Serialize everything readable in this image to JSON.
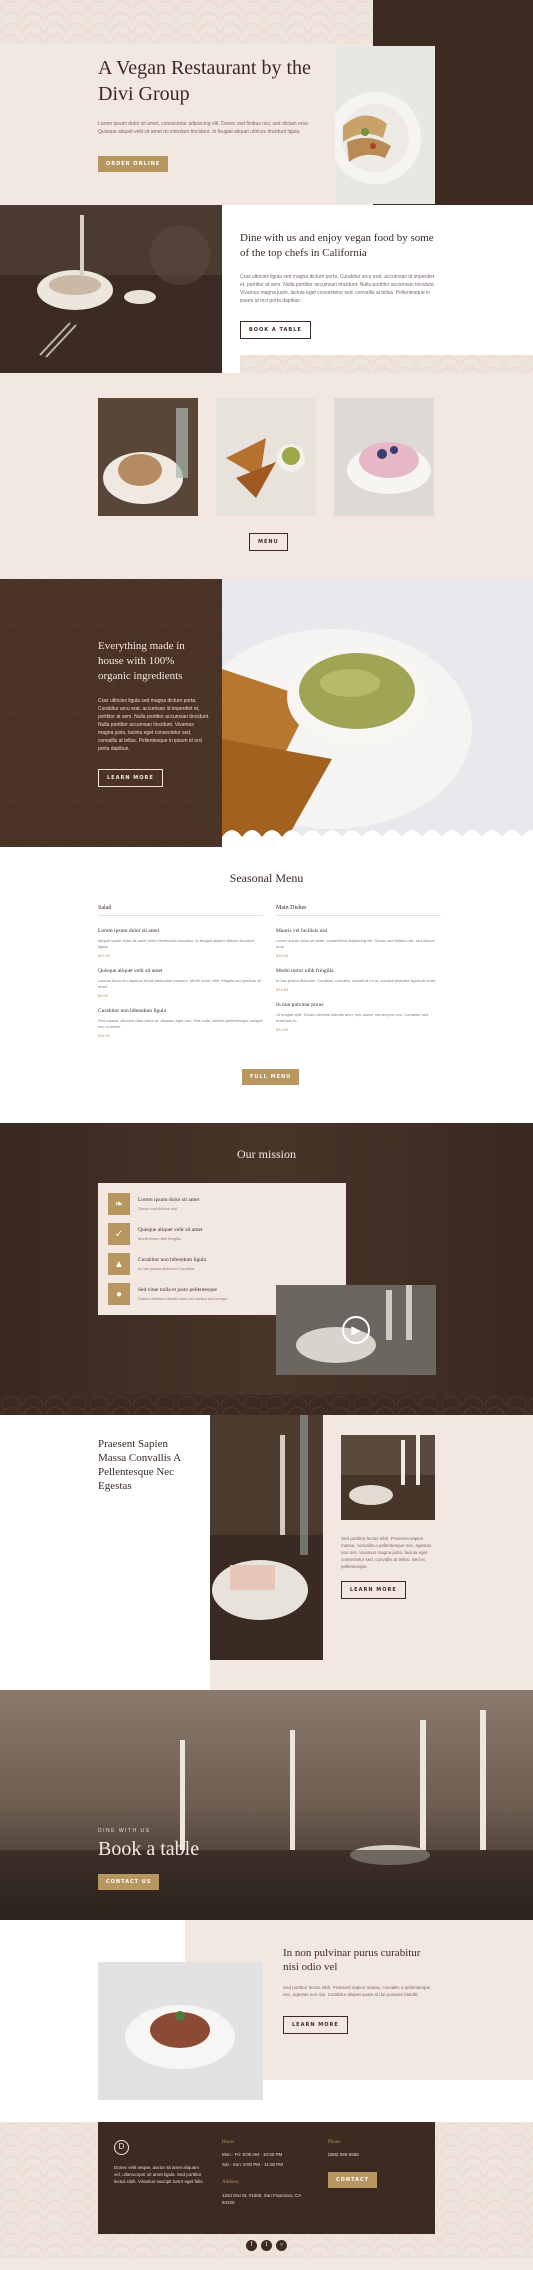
{
  "hero": {
    "title": "A Vegan Restaurant by the Divi Group",
    "text": "Lorem ipsum dolor sit amet, consectetur adipiscing elit. Donec sed finibus nisi, sed dictum eros. Quisque aliquet velit sit amet mi interdum tincidunt. In feugiat aliquet ultrices tincidunt ligula.",
    "button": "Order Online"
  },
  "dine": {
    "title": "Dine with us and enjoy vegan food by some of the top chefs in California",
    "text": "Cras ultricies ligula sed magna dictum porta. Curabitur arcu erat, accumsan id imperdiet et, porttitor at sem. Nulla porttitor accumsan tincidunt. Nulla porttitor accumsan tincidunt. Vivamus magna justo, lacinia eget consectetur sed, convallis at tellus. Pellentesque in ipsum id orci porta dapibus.",
    "button": "Book a table"
  },
  "gallery": {
    "button": "Menu"
  },
  "organic": {
    "title": "Everything made in house with 100% organic ingredients",
    "text": "Cras ultricies ligula sed magna dictum porta. Curabitur arcu erat, accumsan id imperdiet et, porttitor at sem. Nulla porttitor accumsan tincidunt. Nulla porttitor accumsan tincidunt. Vivamus magna justo, lacinia eget consectetur sed, convallis at tellus. Pellentesque in ipsum id orci porta dapibus.",
    "button": "Learn more"
  },
  "menu": {
    "title": "Seasonal Menu",
    "columns": [
      {
        "heading": "Salad",
        "items": [
          {
            "name": "Lorem ipsum dolor sit amet",
            "desc": "Aliquet quam dolor sit amet enim elementum faucibus. In feugiat aliquet ultrices tincidunt ligula.",
            "price": "$12.00"
          },
          {
            "name": "Quisque aliquet velit sit amet",
            "desc": "Lacinia tortor leo dapibus turpis bibendum posuere. Morbi tortor nibh, fringilla sed pretium sit amet.",
            "price": "$9.00"
          },
          {
            "name": "Curabitur non bibendum ligula",
            "desc": "Sed massa, ultricies vitae tortor at, aliquam eget orci. Sed nulla, ultrices pellentesque congue nec ut lorem.",
            "price": "$11.50"
          }
        ]
      },
      {
        "heading": "Main Dishes",
        "items": [
          {
            "name": "Mauris vel facilisis nisl",
            "desc": "Lorem ipsum dolor sit amet, consectetur adipiscing elit. Donec sed finibus nisi, sed dictum eros.",
            "price": "$16.00"
          },
          {
            "name": "Morbi tortor nibh fringilla",
            "desc": "In hac platea dictumst. Curabitur convallis, blandit id mi ut, suscipit pharetra ligula sit amet.",
            "price": "$18.50"
          },
          {
            "name": "In non pulvinar purus",
            "desc": "Ut feugiat velit. Donec ultricies lobortis arcu, nec auctor nisi tempor non. Curabitur sed euismod ex.",
            "price": "$14.00"
          }
        ]
      }
    ],
    "button": "Full menu"
  },
  "mission": {
    "title": "Our mission",
    "items": [
      {
        "icon": "leaf-icon",
        "title": "Lorem ipsum dolor sit amet",
        "desc": "Donec sed finibus nisi"
      },
      {
        "icon": "vegan-icon",
        "title": "Quisque aliquet velit sit amet",
        "desc": "Morbi tortor nibh fringilla"
      },
      {
        "icon": "carrot-icon",
        "title": "Curabitur non bibendum ligula",
        "desc": "In hac platea dictumst Curabitur"
      },
      {
        "icon": "onion-icon",
        "title": "Sed vitae nulla et justo pellentesque",
        "desc": "Donec ultricies lobortis arcu nec auctor nisi tempor"
      }
    ]
  },
  "praesent": {
    "title": "Praesent Sapien Massa Convallis A Pellentesque Nec Egestas",
    "text": "Sed porttitor lectus nibh. Praesent sapien massa, convallis a pellentesque nec, egestas non nisi. Vivamus magna justo, lacinia eget consectetur sed, convallis at tellus. Sed et pellentesque.",
    "button": "Learn more"
  },
  "book": {
    "kicker": "Dine with us",
    "title": "Book a table",
    "button": "Contact us"
  },
  "pulvinar": {
    "title": "In non pulvinar purus curabitur nisi odio vel",
    "text": "Sed porttitor lectus nibh. Praesent sapien massa, convallis a pellentesque nec, egestas non nisi. Curabitur aliquet quam id dui posuere blandit.",
    "button": "Learn more"
  },
  "footer": {
    "logo": "D",
    "about": "Donec velit neque, auctor sit amet aliquam vel, ullamcorper sit amet ligula. Sed porttitor lectus nibh. Vivamus suscipit tortor eget felis.",
    "hours_title": "Hours",
    "hours": [
      "Mon - Fri: 8:00 AM - 10:00 PM",
      "Sat - Sun: 8:00 PM - 11:00 PM"
    ],
    "address_title": "Address",
    "address": "1234 Divi St. #1000, San Francisco, CA 94220",
    "phone_title": "Phone",
    "phone": "(555) 555-5555",
    "button": "Contact",
    "social": [
      "facebook-icon",
      "twitter-icon",
      "instagram-icon"
    ]
  },
  "colors": {
    "brown": "#3d2a20",
    "cream": "#f2e8e1",
    "gold": "#b8965f"
  }
}
